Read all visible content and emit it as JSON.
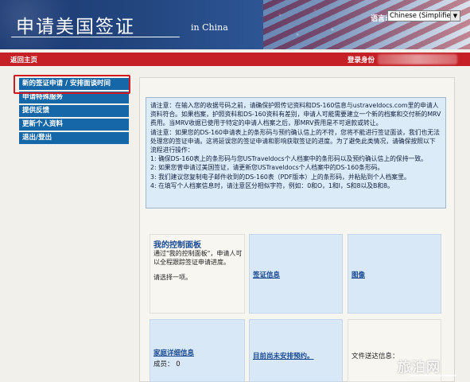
{
  "header": {
    "site_title": "申请美国签证",
    "country_suffix": "in China",
    "language_label": "语言:",
    "language_selected": "Chinese (Simplified)"
  },
  "navbar": {
    "home": "返回主页",
    "login_label": "登录身份"
  },
  "sidebar": {
    "items": [
      {
        "label": "新的签证申请 / 安排面谈时间"
      },
      {
        "label": "申请特殊服务"
      },
      {
        "label": "提供反馈"
      },
      {
        "label": "更新个人资料"
      },
      {
        "label": "退出/登出"
      }
    ]
  },
  "notice": {
    "para1": "请注意：在输入您的收据号码之前，请确保护照传记资料和DS-160信息与ustraveldocs.com里的申请人资料符合。如果档案，护照资料和DS-160资料有差别，申请人可能需要建立一个新的档案和交付新的MRV费用。当MRV收据已使用于特定的申请人档案之后，那MRV费用是不可退款或转让。",
    "para2": "请注意：如果您的DS-160申请表上的条形码与预约确认信上的不符，您将不能进行签证面谈，我们也无法处理您的签证申请。这将延误您的签证申请和影响获取签证的进度。为了避免此类情况，请确保按照以下流程进行操作：",
    "step1": "1: 确保DS-160表上的条形码与您USTraveldocs个人档案中的条形码以及预约确认信上的保持一致。",
    "step2": "2: 如果您曾申请过美国签证，请更新您USTraveldocs个人档案中的DS-160条形码。",
    "step3": "3: 我们建议您复制电子邮件收到的DS-160表（PDF版本）上的条形码，并粘贴到个人档案里。",
    "step4": "4: 在填写个人档案信息时，请注意区分相似字符，例如：0和O，1和I，S和8以及B和8。"
  },
  "dashboard": {
    "title": "我的控制面板",
    "description": "通过\"我的控制面板\"，申请人可以全程跟踪签证申请进度。",
    "choose": "请选择一项。",
    "visa_info": "签证信息",
    "images": "图像",
    "family_details": "家庭详细信息",
    "members": "成员： 0",
    "unscheduled": "目前尚未安排预约。",
    "doc_delivery": "文件送达信息："
  },
  "watermark": "旅泊网"
}
